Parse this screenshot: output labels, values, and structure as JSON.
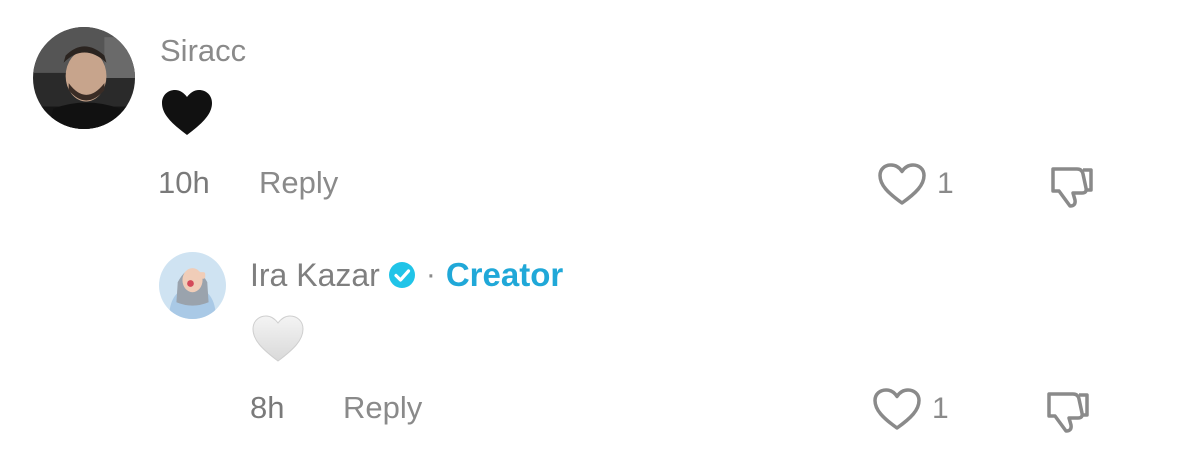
{
  "comments": [
    {
      "username": "Siracc",
      "emoji": "black-heart",
      "time": "10h",
      "reply_label": "Reply",
      "like_count": "1"
    },
    {
      "username": "Ira Kazar",
      "verified": true,
      "separator": "·",
      "badge": "Creator",
      "emoji": "white-heart",
      "time": "8h",
      "reply_label": "Reply",
      "like_count": "1"
    }
  ],
  "colors": {
    "text_gray": "#8a8a8a",
    "creator_blue": "#20a8d8",
    "verified_blue": "#20c4e8"
  }
}
